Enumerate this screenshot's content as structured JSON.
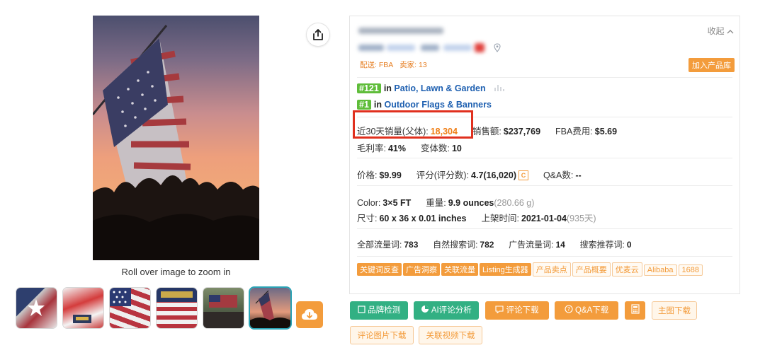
{
  "image": {
    "zoom_hint": "Roll over image to zoom in",
    "thumbnails": [
      "flag-folded-thumb",
      "flag-packaged-thumb",
      "flag-stars-stripes-thumb",
      "flag-label-thumb",
      "flag-crowd-thumb",
      "flag-sunset-thumb"
    ],
    "selected_thumbnail": 6
  },
  "panel": {
    "collapse_label": "收起",
    "shipping": "配送: FBA",
    "sellers": "卖家: 13",
    "add_library": "加入产品库",
    "ranks": [
      {
        "rank": "#121",
        "in": "in",
        "category": "Patio, Lawn & Garden"
      },
      {
        "rank": "#1",
        "in": "in",
        "category": "Outdoor Flags & Banners"
      }
    ],
    "sales": {
      "monthly_label": "近30天销量(父体):",
      "monthly_value": "18,304",
      "revenue_label": "销售额:",
      "revenue_value": "$237,769",
      "fba_label": "FBA费用:",
      "fba_value": "$5.69",
      "margin_label": "毛利率:",
      "margin_value": "41%",
      "variants_label": "变体数:",
      "variants_value": "10"
    },
    "pricing": {
      "price_label": "价格:",
      "price_value": "$9.99",
      "rating_label": "评分(评分数):",
      "rating_value": "4.7(16,020)",
      "c_badge": "C",
      "qa_label": "Q&A数:",
      "qa_value": "--"
    },
    "specs": {
      "color_label": "Color:",
      "color_value": "3×5 FT",
      "weight_label": "重量:",
      "weight_value": "9.9 ounces",
      "weight_grams": "(280.66 g)",
      "size_label": "尺寸:",
      "size_value": "60 x 36 x 0.01 inches",
      "listed_label": "上架时间:",
      "listed_value": "2021-01-04",
      "listed_days": "(935天)"
    },
    "traffic": {
      "all_label": "全部流量词:",
      "all_value": "783",
      "organic_label": "自然搜索词:",
      "organic_value": "782",
      "ad_label": "广告流量词:",
      "ad_value": "14",
      "recommend_label": "搜索推荐词:",
      "recommend_value": "0"
    },
    "tool_tags": [
      {
        "label": "关键词反查",
        "style": "solid"
      },
      {
        "label": "广告洞察",
        "style": "solid"
      },
      {
        "label": "关联流量",
        "style": "solid"
      },
      {
        "label": "Listing生成器",
        "style": "solid"
      },
      {
        "label": "产品卖点",
        "style": "outline"
      },
      {
        "label": "产品概要",
        "style": "outline"
      },
      {
        "label": "优麦云",
        "style": "outline"
      },
      {
        "label": "Alibaba",
        "style": "outline"
      },
      {
        "label": "1688",
        "style": "outline"
      }
    ]
  },
  "actions": {
    "brand_check": "品牌检测",
    "ai_review": "AI评论分析",
    "review_download": "评论下载",
    "qa_download": "Q&A下载",
    "main_image_download": "主图下载",
    "review_image_download": "评论图片下载",
    "related_video_download": "关联视频下载"
  },
  "colors": {
    "accent_orange": "#f39c3c",
    "sales_orange": "#ef7d14",
    "green": "#32b083",
    "rank_green": "#5fbd3a",
    "link_blue": "#1d5fb0",
    "highlight_red": "#e0301e"
  }
}
